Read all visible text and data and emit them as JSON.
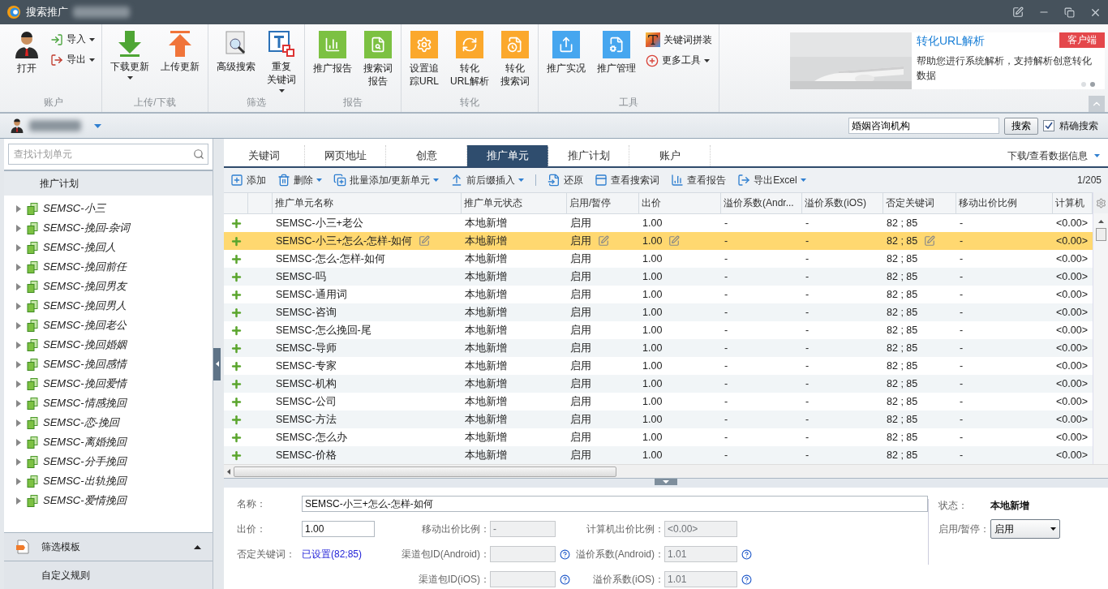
{
  "window": {
    "title": "搜索推广"
  },
  "ribbon": {
    "groups": [
      {
        "label": "账户",
        "tools": [
          {
            "label": "打开",
            "kind": "large",
            "dropdown": false
          },
          {
            "label": "导入",
            "kind": "small",
            "dropdown": true
          },
          {
            "label": "导出",
            "kind": "small",
            "dropdown": true
          }
        ]
      },
      {
        "label": "上传/下载",
        "tools": [
          {
            "label": "下载更新",
            "kind": "large",
            "dropdown": true
          },
          {
            "label": "上传更新",
            "kind": "large",
            "dropdown": false
          }
        ]
      },
      {
        "label": "筛选",
        "tools": [
          {
            "label": "高级搜索",
            "kind": "large",
            "dropdown": false
          },
          {
            "lines": [
              "重复",
              "关键词"
            ],
            "kind": "large",
            "dropdown": true
          }
        ]
      },
      {
        "label": "报告",
        "tools": [
          {
            "label": "推广报告",
            "kind": "tile",
            "dropdown": false
          },
          {
            "lines": [
              "搜索词",
              "报告"
            ],
            "kind": "tile",
            "dropdown": false
          }
        ]
      },
      {
        "label": "转化",
        "tools": [
          {
            "lines": [
              "设置追",
              "踪URL"
            ],
            "kind": "tile",
            "dropdown": false
          },
          {
            "lines": [
              "转化",
              "URL解析"
            ],
            "kind": "tile",
            "dropdown": false
          },
          {
            "lines": [
              "转化",
              "搜索词"
            ],
            "kind": "tile",
            "dropdown": false
          }
        ]
      },
      {
        "label": "工具",
        "tools": [
          {
            "label": "推广实况",
            "kind": "tile",
            "dropdown": false
          },
          {
            "label": "推广管理",
            "kind": "tile",
            "dropdown": false
          },
          {
            "label": "关键词拼装",
            "kind": "small",
            "dropdown": false
          },
          {
            "label": "更多工具",
            "kind": "small",
            "dropdown": true
          }
        ]
      }
    ]
  },
  "banner": {
    "title": "转化URL解析",
    "text": "帮助您进行系统解析，支持解析创意转化数据",
    "badge": "客户端",
    "slides": [
      {
        "selected": false
      },
      {
        "selected": true
      }
    ]
  },
  "account_bar": {
    "search": {
      "value": "婚姻咨询机构"
    },
    "search_button": "搜索",
    "exact": {
      "label": "精确搜索",
      "checked": true
    }
  },
  "sidebar": {
    "search": {
      "placeholder": "查找计划单元"
    },
    "heading": "推广计划",
    "plans": [
      {
        "name": "SEMSC-小三",
        "expanded": false
      },
      {
        "name": "SEMSC-挽回-杂词",
        "expanded": false
      },
      {
        "name": "SEMSC-挽回人",
        "expanded": false
      },
      {
        "name": "SEMSC-挽回前任",
        "expanded": false
      },
      {
        "name": "SEMSC-挽回男友",
        "expanded": false
      },
      {
        "name": "SEMSC-挽回男人",
        "expanded": false
      },
      {
        "name": "SEMSC-挽回老公",
        "expanded": false
      },
      {
        "name": "SEMSC-挽回婚姻",
        "expanded": false
      },
      {
        "name": "SEMSC-挽回感情",
        "expanded": false
      },
      {
        "name": "SEMSC-挽回爱情",
        "expanded": false
      },
      {
        "name": "SEMSC-情感挽回",
        "expanded": false
      },
      {
        "name": "SEMSC-恋-挽回",
        "expanded": false
      },
      {
        "name": "SEMSC-离婚挽回",
        "expanded": false
      },
      {
        "name": "SEMSC-分手挽回",
        "expanded": false
      },
      {
        "name": "SEMSC-出轨挽回",
        "expanded": false
      },
      {
        "name": "SEMSC-爱情挽回",
        "expanded": false
      }
    ],
    "filter_panel": {
      "label": "筛选模板",
      "expanded": true
    },
    "custom_rule": "自定义规则"
  },
  "tabs": [
    {
      "label": "关键词",
      "selected": false
    },
    {
      "label": "网页地址",
      "selected": false
    },
    {
      "label": "创意",
      "selected": false
    },
    {
      "label": "推广单元",
      "selected": true
    },
    {
      "label": "推广计划",
      "selected": false
    },
    {
      "label": "账户",
      "selected": false
    }
  ],
  "data_menu": "下载/查看数据信息",
  "toolbar": {
    "left": [
      {
        "label": "添加",
        "dropdown": false
      },
      {
        "label": "删除",
        "dropdown": true
      },
      {
        "label": "批量添加/更新单元",
        "dropdown": true
      },
      {
        "label": "前后缀插入",
        "dropdown": true
      }
    ],
    "right": [
      {
        "label": "还原",
        "dropdown": false
      },
      {
        "label": "查看搜索词",
        "dropdown": false
      },
      {
        "label": "查看报告",
        "dropdown": false
      },
      {
        "label": "导出Excel",
        "dropdown": true
      }
    ],
    "page": "1/205"
  },
  "table": {
    "columns": [
      "推广单元名称",
      "推广单元状态",
      "启用/暂停",
      "出价",
      "溢价系数(Andr...",
      "溢价系数(iOS)",
      "否定关键词",
      "移动出价比例",
      "计算机"
    ],
    "rows": [
      {
        "name": "SEMSC-小三+老公",
        "status": "本地新增",
        "enabled": "启用",
        "bid": "1.00",
        "android": "-",
        "ios": "-",
        "negative": "82 ; 85",
        "mobile": "-",
        "pc": "<0.00>",
        "selected": false
      },
      {
        "name": "SEMSC-小三+怎么-怎样-如何",
        "status": "本地新增",
        "enabled": "启用",
        "bid": "1.00",
        "android": "-",
        "ios": "-",
        "negative": "82 ; 85",
        "mobile": "-",
        "pc": "<0.00>",
        "selected": true
      },
      {
        "name": "SEMSC-怎么-怎样-如何",
        "status": "本地新增",
        "enabled": "启用",
        "bid": "1.00",
        "android": "-",
        "ios": "-",
        "negative": "82 ; 85",
        "mobile": "-",
        "pc": "<0.00>",
        "selected": false
      },
      {
        "name": "SEMSC-吗",
        "status": "本地新增",
        "enabled": "启用",
        "bid": "1.00",
        "android": "-",
        "ios": "-",
        "negative": "82 ; 85",
        "mobile": "-",
        "pc": "<0.00>",
        "selected": false
      },
      {
        "name": "SEMSC-通用词",
        "status": "本地新增",
        "enabled": "启用",
        "bid": "1.00",
        "android": "-",
        "ios": "-",
        "negative": "82 ; 85",
        "mobile": "-",
        "pc": "<0.00>",
        "selected": false
      },
      {
        "name": "SEMSC-咨询",
        "status": "本地新增",
        "enabled": "启用",
        "bid": "1.00",
        "android": "-",
        "ios": "-",
        "negative": "82 ; 85",
        "mobile": "-",
        "pc": "<0.00>",
        "selected": false
      },
      {
        "name": "SEMSC-怎么挽回-尾",
        "status": "本地新增",
        "enabled": "启用",
        "bid": "1.00",
        "android": "-",
        "ios": "-",
        "negative": "82 ; 85",
        "mobile": "-",
        "pc": "<0.00>",
        "selected": false
      },
      {
        "name": "SEMSC-导师",
        "status": "本地新增",
        "enabled": "启用",
        "bid": "1.00",
        "android": "-",
        "ios": "-",
        "negative": "82 ; 85",
        "mobile": "-",
        "pc": "<0.00>",
        "selected": false
      },
      {
        "name": "SEMSC-专家",
        "status": "本地新增",
        "enabled": "启用",
        "bid": "1.00",
        "android": "-",
        "ios": "-",
        "negative": "82 ; 85",
        "mobile": "-",
        "pc": "<0.00>",
        "selected": false
      },
      {
        "name": "SEMSC-机构",
        "status": "本地新增",
        "enabled": "启用",
        "bid": "1.00",
        "android": "-",
        "ios": "-",
        "negative": "82 ; 85",
        "mobile": "-",
        "pc": "<0.00>",
        "selected": false
      },
      {
        "name": "SEMSC-公司",
        "status": "本地新增",
        "enabled": "启用",
        "bid": "1.00",
        "android": "-",
        "ios": "-",
        "negative": "82 ; 85",
        "mobile": "-",
        "pc": "<0.00>",
        "selected": false
      },
      {
        "name": "SEMSC-方法",
        "status": "本地新增",
        "enabled": "启用",
        "bid": "1.00",
        "android": "-",
        "ios": "-",
        "negative": "82 ; 85",
        "mobile": "-",
        "pc": "<0.00>",
        "selected": false
      },
      {
        "name": "SEMSC-怎么办",
        "status": "本地新增",
        "enabled": "启用",
        "bid": "1.00",
        "android": "-",
        "ios": "-",
        "negative": "82 ; 85",
        "mobile": "-",
        "pc": "<0.00>",
        "selected": false
      },
      {
        "name": "SEMSC-价格",
        "status": "本地新增",
        "enabled": "启用",
        "bid": "1.00",
        "android": "-",
        "ios": "-",
        "negative": "82 ; 85",
        "mobile": "-",
        "pc": "<0.00>",
        "selected": false
      }
    ]
  },
  "details": {
    "name": {
      "label": "名称：",
      "value": "SEMSC-小三+怎么-怎样-如何",
      "disabled": false
    },
    "bid": {
      "label": "出价：",
      "value": "1.00",
      "disabled": false
    },
    "mobile_ratio": {
      "label": "移动出价比例：",
      "value": "-",
      "disabled": true
    },
    "pc_ratio": {
      "label": "计算机出价比例：",
      "value": "<0.00>",
      "disabled": true
    },
    "negative": {
      "label": "否定关键词：",
      "link": "已设置(82;85)"
    },
    "android_channel": {
      "label": "渠道包ID(Android)：",
      "disabled": true
    },
    "android_coeff": {
      "label": "溢价系数(Android)：",
      "value": "1.01",
      "disabled": true
    },
    "ios_channel": {
      "label": "渠道包ID(iOS)：",
      "disabled": true
    },
    "ios_coeff": {
      "label": "溢价系数(iOS)：",
      "value": "1.01",
      "disabled": true
    },
    "status": {
      "label": "状态：",
      "value": "本地新增"
    },
    "enabled": {
      "label": "启用/暂停：",
      "value": "启用"
    }
  }
}
